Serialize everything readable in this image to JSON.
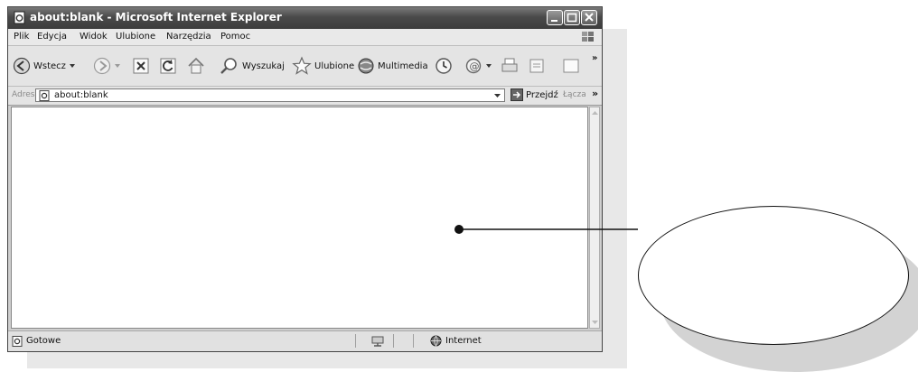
{
  "window": {
    "title": "about:blank - Microsoft Internet Explorer"
  },
  "menu": {
    "items": [
      "Plik",
      "Edycja",
      "Widok",
      "Ulubione",
      "Narzędzia",
      "Pomoc"
    ]
  },
  "toolbar": {
    "back_label": "Wstecz",
    "search_label": "Wyszukaj",
    "favorites_label": "Ulubione",
    "media_label": "Multimedia",
    "overflow": "»"
  },
  "address": {
    "label": "Adres",
    "value": "about:blank",
    "go_label": "Przejdź",
    "links_label": "Łącza",
    "overflow": "»"
  },
  "status": {
    "text": "Gotowe",
    "zone": "Internet"
  },
  "callout": {
    "text": ""
  }
}
